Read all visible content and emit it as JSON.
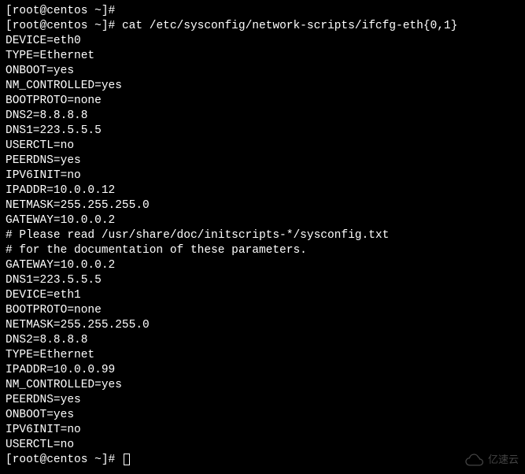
{
  "prompt1": "[root@centos ~]# ",
  "prompt2": "[root@centos ~]# ",
  "command": "cat /etc/sysconfig/network-scripts/ifcfg-eth{0,1}",
  "output": [
    "DEVICE=eth0",
    "TYPE=Ethernet",
    "ONBOOT=yes",
    "NM_CONTROLLED=yes",
    "BOOTPROTO=none",
    "DNS2=8.8.8.8",
    "DNS1=223.5.5.5",
    "USERCTL=no",
    "PEERDNS=yes",
    "IPV6INIT=no",
    "IPADDR=10.0.0.12",
    "NETMASK=255.255.255.0",
    "GATEWAY=10.0.0.2",
    "# Please read /usr/share/doc/initscripts-*/sysconfig.txt",
    "# for the documentation of these parameters.",
    "GATEWAY=10.0.0.2",
    "DNS1=223.5.5.5",
    "DEVICE=eth1",
    "BOOTPROTO=none",
    "NETMASK=255.255.255.0",
    "DNS2=8.8.8.8",
    "TYPE=Ethernet",
    "IPADDR=10.0.0.99",
    "NM_CONTROLLED=yes",
    "PEERDNS=yes",
    "ONBOOT=yes",
    "IPV6INIT=no",
    "USERCTL=no"
  ],
  "prompt3": "[root@centos ~]# ",
  "watermark_text": "亿速云"
}
